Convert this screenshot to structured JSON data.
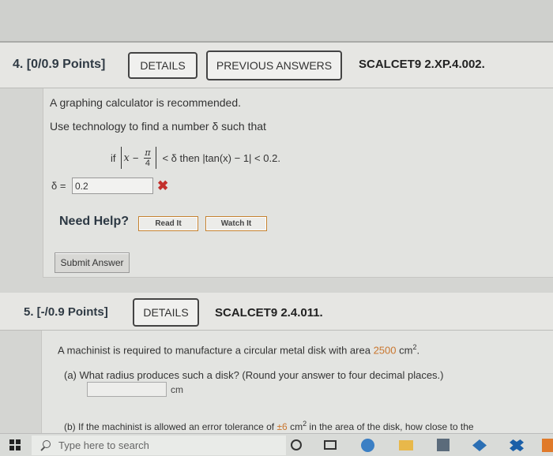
{
  "q4": {
    "title": "4. [0/0.9 Points]",
    "details_label": "DETAILS",
    "previous_answers_label": "PREVIOUS ANSWERS",
    "code": "SCALCET9 2.XP.4.002.",
    "line1": "A graphing calculator is recommended.",
    "line2": "Use technology to find a number δ such that",
    "math": {
      "if": "if",
      "x": "x",
      "minus": "−",
      "pi": "π",
      "four": "4",
      "rest": "< δ then |tan(x) − 1| < 0.2."
    },
    "delta_label": "δ =",
    "answer_value": "0.2",
    "status_mark": "✖",
    "need_help": "Need Help?",
    "read_it": "Read It",
    "watch_it": "Watch It",
    "submit": "Submit Answer"
  },
  "q5": {
    "title": "5. [-/0.9 Points]",
    "details_label": "DETAILS",
    "code": "SCALCET9 2.4.011.",
    "line1_pre": "A machinist is required to manufacture a circular metal disk with area ",
    "area_value": "2500",
    "line1_unit": " cm",
    "line1_sup": "2",
    "line1_end": ".",
    "part_a": "(a)  What radius produces such a disk? (Round your answer to four decimal places.)",
    "unit": "cm",
    "part_b_pre": "(b)  If the machinist is allowed an error tolerance of ",
    "tolerance": "±6",
    "part_b_unit": " cm",
    "part_b_sup": "2",
    "part_b_end": " in the area of the disk, how close to the"
  },
  "taskbar": {
    "search_placeholder": "Type here to search"
  },
  "colors": {
    "error": "#c3302c",
    "highlight": "#c9762e",
    "button_border": "#c4812f"
  }
}
